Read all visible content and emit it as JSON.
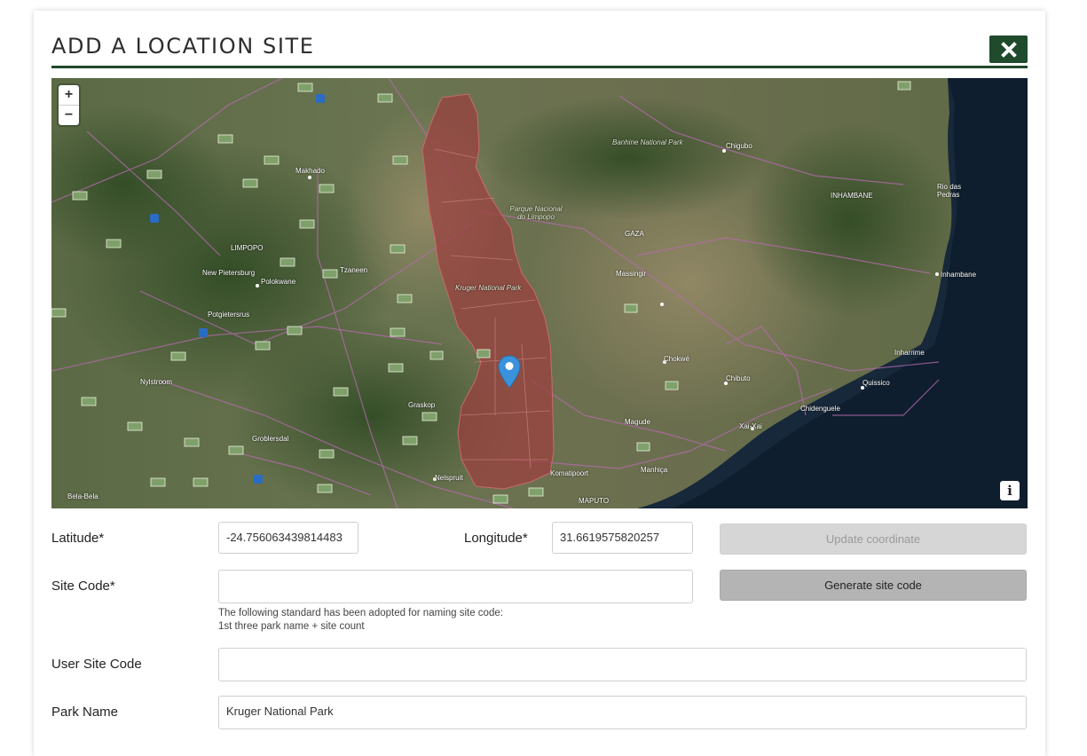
{
  "modal": {
    "title": "ADD A LOCATION SITE",
    "close_icon": "times-icon",
    "accent_color": "#1f4a2c"
  },
  "map": {
    "zoom_in_label": "+",
    "zoom_out_label": "−",
    "info_label": "i",
    "marker_icon": "map-pin-icon",
    "place_labels": {
      "makhado": "Makhado",
      "limpopo": "LIMPOPO",
      "new_pietersburg": "New Pietersburg",
      "polokwane": "Polokwane",
      "tzaneen": "Tzaneen",
      "potgietersrus": "Potgietersrus",
      "nylstroom": "Nylstroom",
      "groblersdal": "Groblersdal",
      "graskop": "Graskop",
      "nelspruit": "Nelspruit",
      "komatipoort": "Komatipoort",
      "maputo": "MAPUTO",
      "parque": "Parque Nacional do Limpopo",
      "kruger": "Kruger National Park",
      "banhine": "Banhine National Park",
      "gaza": "GAZA",
      "inhambane_prov": "INHAMBANE",
      "inhambane": "Inhambane",
      "chokwe": "Chokwé",
      "chibuto": "Chibuto",
      "xai_xai": "Xai-Xai",
      "chidenguele": "Chidenguele",
      "quissico": "Quissico",
      "inharrime": "Inharrime",
      "magude": "Magude",
      "manhica": "Manhiça",
      "massingir": "Massingir",
      "chigubo": "Chigubo",
      "rio_das_pedras": "Rio das Pedras",
      "bela_bela": "Bela-Bela"
    }
  },
  "form": {
    "latitude_label": "Latitude*",
    "latitude_value": "-24.756063439814483",
    "longitude_label": "Longitude*",
    "longitude_value": "31.6619575820257",
    "update_button": "Update coordinate",
    "site_code_label": "Site Code*",
    "site_code_value": "",
    "generate_button": "Generate site code",
    "help_line1": "The following standard has been adopted for naming site code:",
    "help_line2": "1st three park name + site count",
    "user_site_code_label": "User Site Code",
    "user_site_code_value": "",
    "park_name_label": "Park Name",
    "park_name_value": "Kruger National Park"
  }
}
